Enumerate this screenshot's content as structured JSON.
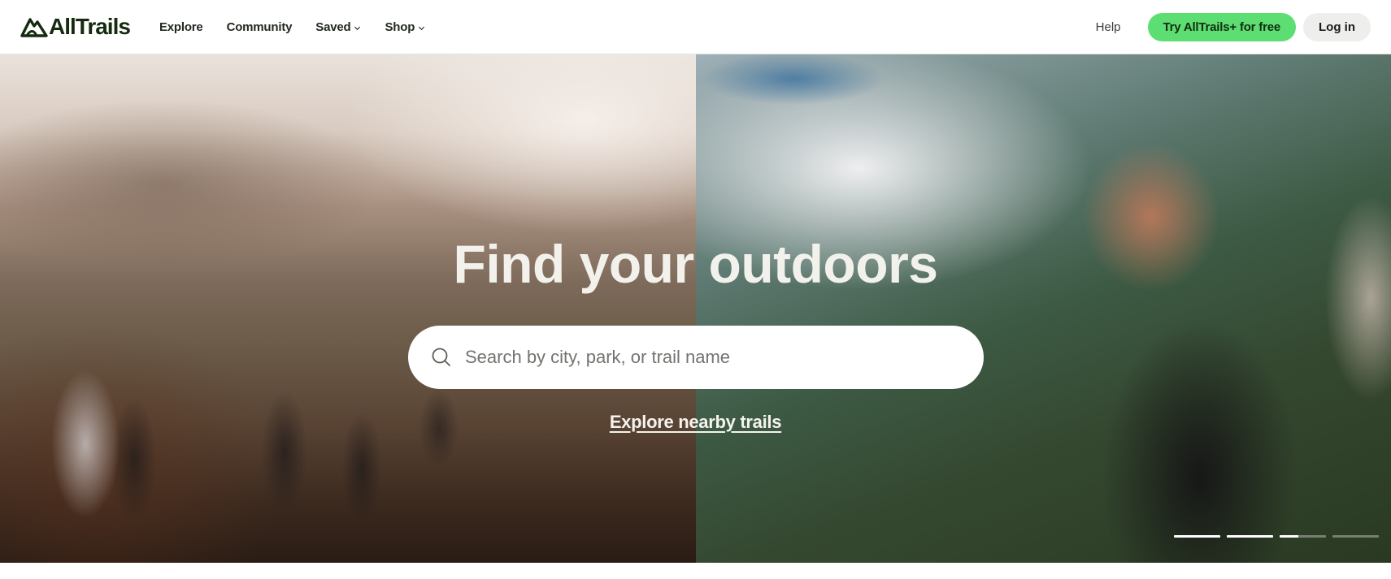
{
  "header": {
    "brand": "AllTrails",
    "nav": [
      {
        "label": "Explore",
        "dropdown": false
      },
      {
        "label": "Community",
        "dropdown": false
      },
      {
        "label": "Saved",
        "dropdown": true
      },
      {
        "label": "Shop",
        "dropdown": true
      }
    ],
    "help_label": "Help",
    "cta_label": "Try AllTrails+ for free",
    "login_label": "Log in"
  },
  "hero": {
    "headline": "Find your outdoors",
    "search": {
      "placeholder": "Search by city, park, or trail name",
      "value": ""
    },
    "explore_link": "Explore nearby trails",
    "carousel": {
      "slides": [
        {
          "progress": 1.0
        },
        {
          "progress": 1.0
        },
        {
          "progress": 0.4
        },
        {
          "progress": 0.0
        }
      ]
    }
  },
  "colors": {
    "brand_dark": "#142b0f",
    "cta_green": "#5cde73",
    "login_bg": "#eeeeec"
  }
}
